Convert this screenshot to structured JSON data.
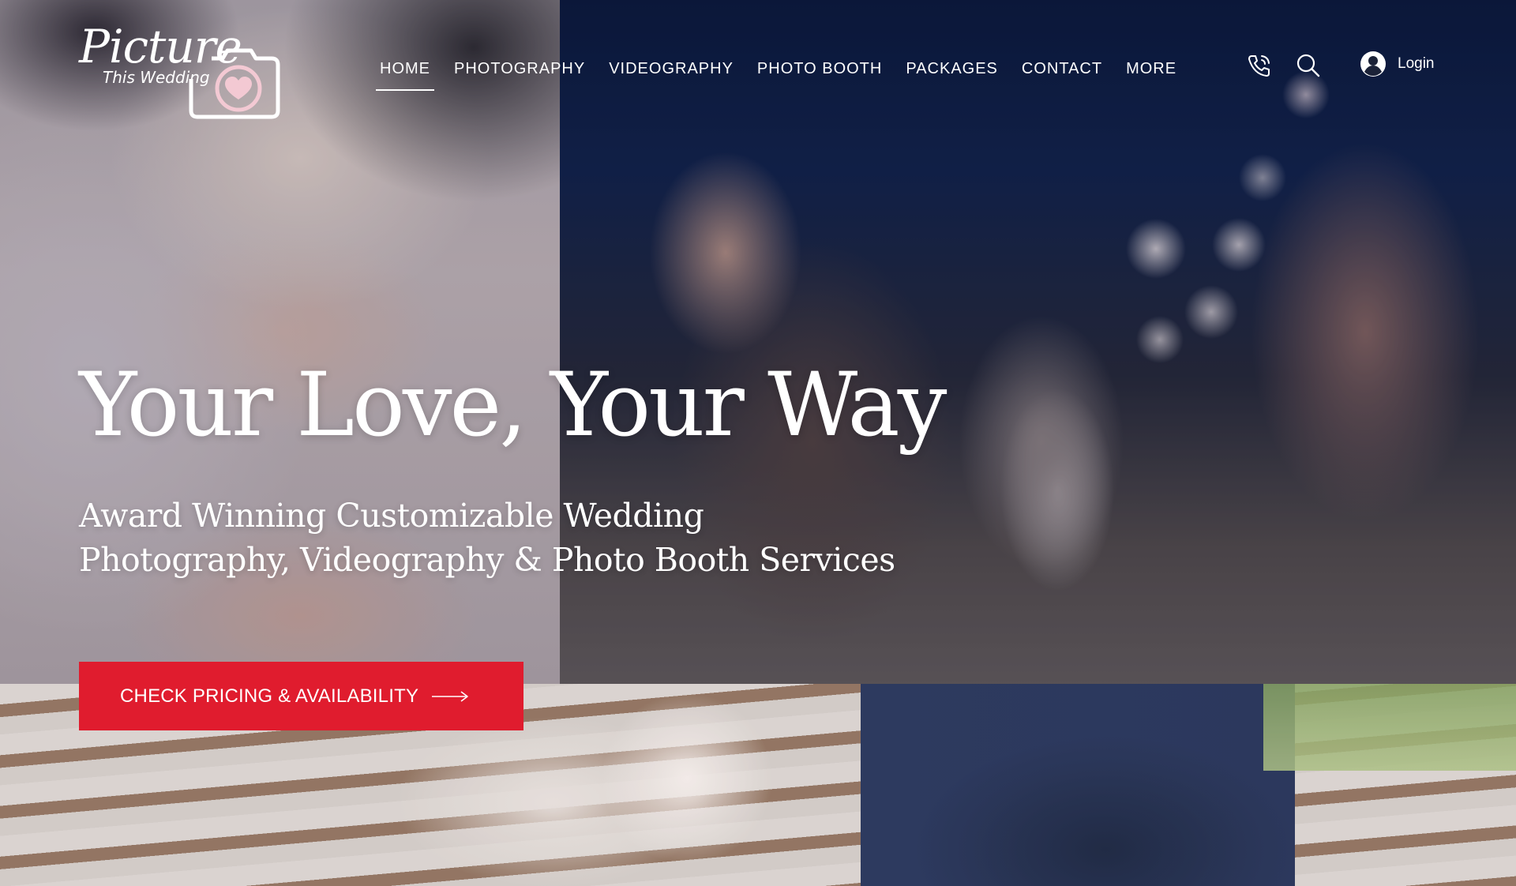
{
  "logo": {
    "script_text": "Picture",
    "sub_text": "This Wedding"
  },
  "nav": {
    "items": [
      {
        "label": "HOME",
        "active": true
      },
      {
        "label": "PHOTOGRAPHY",
        "active": false
      },
      {
        "label": "VIDEOGRAPHY",
        "active": false
      },
      {
        "label": "PHOTO BOOTH",
        "active": false
      },
      {
        "label": "PACKAGES",
        "active": false
      },
      {
        "label": "CONTACT",
        "active": false
      },
      {
        "label": "MORE",
        "active": false
      }
    ]
  },
  "header_icons": {
    "phone": "phone-icon",
    "search": "search-icon",
    "account": "user-account-icon"
  },
  "login": {
    "label": "Login"
  },
  "hero": {
    "title": "Your Love, Your Way",
    "subtitle": "Award Winning Customizable Wedding Photography, Videography & Photo Booth Services",
    "cta_label": "CHECK PRICING & AVAILABILITY",
    "cta_icon": "arrow-right-icon"
  },
  "colors": {
    "cta_background": "#e01c2e",
    "text": "#ffffff",
    "logo_accent": "#f3c9d3"
  }
}
